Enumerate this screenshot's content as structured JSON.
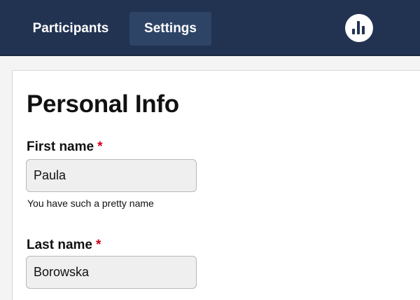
{
  "nav": {
    "tabs": [
      {
        "label": "Participants",
        "active": false
      },
      {
        "label": "Settings",
        "active": true
      }
    ],
    "logo_icon": "bar-chart-icon"
  },
  "form": {
    "title": "Personal Info",
    "required_marker": "*",
    "first_name": {
      "label": "First name",
      "value": "Paula",
      "hint": "You have such a pretty name"
    },
    "last_name": {
      "label": "Last name",
      "value": "Borowska"
    }
  },
  "colors": {
    "topbar": "#223352",
    "active_tab": "#2e4467",
    "required": "#d0021b",
    "input_bg": "#efefef"
  }
}
